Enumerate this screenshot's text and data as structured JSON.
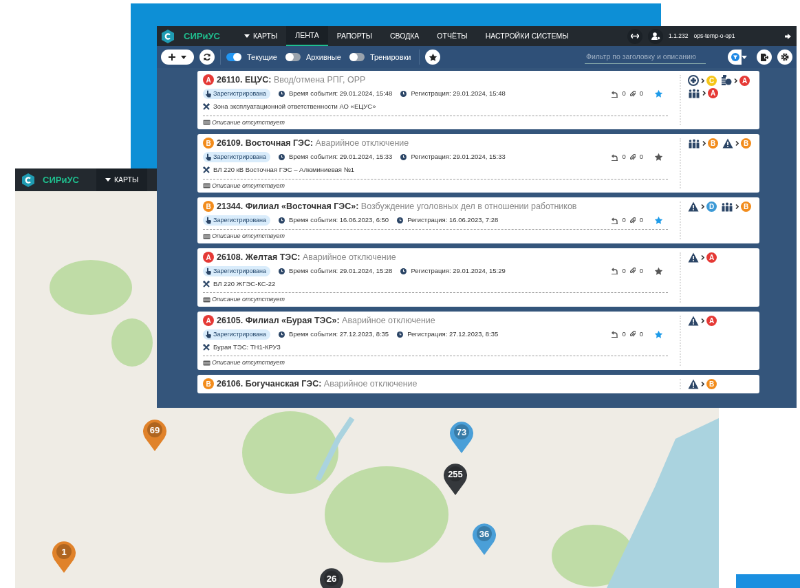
{
  "back_window": {
    "brand": "СИРиУС",
    "menu": [
      {
        "label": "КАРТЫ",
        "dropdown": true
      }
    ],
    "map_pins": [
      {
        "count": "69",
        "color": "#e0822a"
      },
      {
        "count": "73",
        "color": "#4a9fd8"
      },
      {
        "count": "255",
        "color": "#35383c"
      },
      {
        "count": "36",
        "color": "#4a9fd8"
      },
      {
        "count": "1",
        "color": "#e0822a"
      },
      {
        "count": "26",
        "color": "#35383c"
      }
    ]
  },
  "window": {
    "brand": "СИРиУС",
    "menu": [
      {
        "label": "КАРТЫ",
        "dropdown": true,
        "selected": false
      },
      {
        "label": "ЛЕНТА",
        "dropdown": false,
        "selected": true
      },
      {
        "label": "РАПОРТЫ",
        "dropdown": false,
        "selected": false
      },
      {
        "label": "СВОДКА",
        "dropdown": false,
        "selected": false
      },
      {
        "label": "ОТЧЁТЫ",
        "dropdown": false,
        "selected": false
      },
      {
        "label": "НАСТРОЙКИ СИСТЕМЫ",
        "dropdown": false,
        "selected": false
      }
    ],
    "user": {
      "version": "1.1.232",
      "login": "ops-temp-o-op1"
    },
    "toggles": [
      {
        "label": "Текущие",
        "on": true
      },
      {
        "label": "Архивные",
        "on": false
      },
      {
        "label": "Тренировки",
        "on": false
      }
    ],
    "filter": {
      "placeholder": "Фильтр по заголовку и описанию"
    },
    "events": [
      {
        "level": "A",
        "color": "#e53935",
        "number": "26110.",
        "subject": "ЕЦУС:",
        "summary": "Ввод/отмена РПГ, ОРР",
        "status": "Зарегистрирована",
        "event_time": "Время события: 29.01.2024, 15:48",
        "registration": "Регистрация: 29.01.2024, 15:48",
        "object": "Зона эксплуатационной ответственности АО «ЕЦУС»",
        "description": "Описание отсутствует",
        "replies": "0",
        "attachments": "0",
        "starred": true,
        "impacts": [
          {
            "kind": "medical",
            "level": "C",
            "color": "#f5c518"
          },
          {
            "kind": "money",
            "level": "A",
            "color": "#e53935"
          },
          {
            "kind": "people",
            "level": "A",
            "color": "#e53935"
          }
        ]
      },
      {
        "level": "B",
        "color": "#f28c1c",
        "number": "26109.",
        "subject": "Восточная ГЭС:",
        "summary": "Аварийное отключение",
        "status": "Зарегистрирована",
        "event_time": "Время события: 29.01.2024, 15:33",
        "registration": "Регистрация: 29.01.2024, 15:33",
        "object": "ВЛ 220 кВ Восточная ГЭС – Алюминиевая №1",
        "description": "Описание отсутствует",
        "replies": "0",
        "attachments": "0",
        "starred": false,
        "impacts": [
          {
            "kind": "people",
            "level": "B",
            "color": "#f28c1c"
          },
          {
            "kind": "warning",
            "level": "B",
            "color": "#f28c1c"
          }
        ]
      },
      {
        "level": "B",
        "color": "#f28c1c",
        "number": "21344.",
        "subject": "Филиал «Восточная ГЭС»:",
        "summary": "Возбуждение уголовных дел в отношении работников",
        "status": "Зарегистрирована",
        "event_time": "Время события: 16.06.2023, 6:50",
        "registration": "Регистрация: 16.06.2023, 7:28",
        "description": "Описание отсутствует",
        "replies": "0",
        "attachments": "0",
        "starred": true,
        "impacts": [
          {
            "kind": "warning",
            "level": "D",
            "color": "#3d9ad6"
          },
          {
            "kind": "people",
            "level": "B",
            "color": "#f28c1c"
          }
        ]
      },
      {
        "level": "A",
        "color": "#e53935",
        "number": "26108.",
        "subject": "Желтая ТЭС:",
        "summary": "Аварийное отключение",
        "status": "Зарегистрирована",
        "event_time": "Время события: 29.01.2024, 15:28",
        "registration": "Регистрация: 29.01.2024, 15:29",
        "object": "ВЛ 220 ЖГЭС-КС-22",
        "description": "Описание отсутствует",
        "replies": "0",
        "attachments": "0",
        "starred": false,
        "impacts": [
          {
            "kind": "warning",
            "level": "A",
            "color": "#e53935"
          }
        ]
      },
      {
        "level": "A",
        "color": "#e53935",
        "number": "26105.",
        "subject": "Филиал «Бурая ТЭС»:",
        "summary": "Аварийное отключение",
        "status": "Зарегистрирована",
        "event_time": "Время события: 27.12.2023, 8:35",
        "registration": "Регистрация: 27.12.2023, 8:35",
        "object": "Бурая ТЭС: ТН1-КРУ3",
        "description": "Описание отсутствует",
        "replies": "0",
        "attachments": "0",
        "starred": true,
        "impacts": [
          {
            "kind": "warning",
            "level": "A",
            "color": "#e53935"
          }
        ]
      },
      {
        "level": "B",
        "color": "#f28c1c",
        "number": "26106.",
        "subject": "Богучанская ГЭС:",
        "summary": "Аварийное отключение",
        "impacts": [
          {
            "kind": "warning",
            "level": "B",
            "color": "#f28c1c"
          }
        ]
      }
    ]
  }
}
